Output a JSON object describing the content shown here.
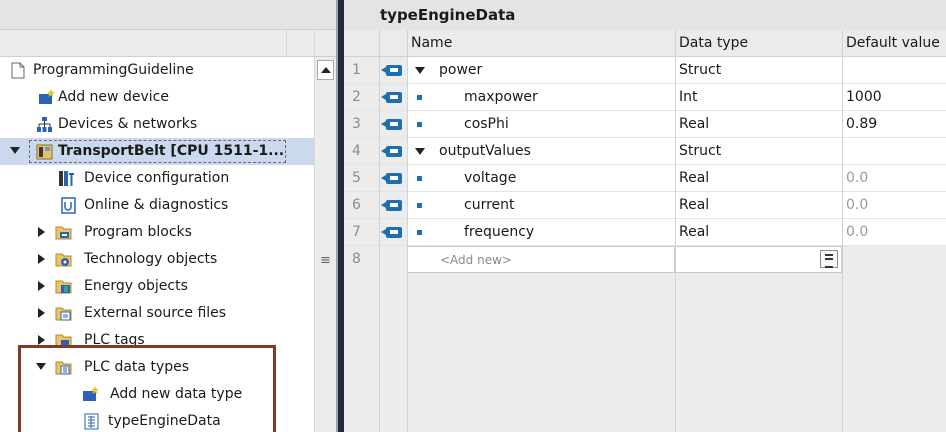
{
  "tree": {
    "items": [
      {
        "label": "ProgrammingGuideline",
        "icon": "project-icon"
      },
      {
        "label": "Add new device",
        "icon": "add-device-icon"
      },
      {
        "label": "Devices & networks",
        "icon": "network-icon"
      },
      {
        "label": "TransportBelt [CPU 1511-1...",
        "icon": "plc-icon"
      },
      {
        "label": "Device configuration",
        "icon": "device-config-icon"
      },
      {
        "label": "Online & diagnostics",
        "icon": "diagnostics-icon"
      },
      {
        "label": "Program blocks",
        "icon": "folder-blocks-icon"
      },
      {
        "label": "Technology objects",
        "icon": "folder-technology-icon"
      },
      {
        "label": "Energy objects",
        "icon": "folder-energy-icon"
      },
      {
        "label": "External source files",
        "icon": "folder-source-icon"
      },
      {
        "label": "PLC tags",
        "icon": "folder-tags-icon"
      },
      {
        "label": "PLC data types",
        "icon": "folder-datatypes-icon"
      },
      {
        "label": "Add new data type",
        "icon": "add-datatype-icon"
      },
      {
        "label": "typeEngineData",
        "icon": "datatype-icon"
      }
    ]
  },
  "editor": {
    "title": "typeEngineData",
    "columns": {
      "name": "Name",
      "type": "Data type",
      "default": "Default value"
    },
    "rows": [
      {
        "num": "1",
        "name": "power",
        "type": "Struct",
        "default": ""
      },
      {
        "num": "2",
        "name": "maxpower",
        "type": "Int",
        "default": "1000"
      },
      {
        "num": "3",
        "name": "cosPhi",
        "type": "Real",
        "default": "0.89"
      },
      {
        "num": "4",
        "name": "outputValues",
        "type": "Struct",
        "default": ""
      },
      {
        "num": "5",
        "name": "voltage",
        "type": "Real",
        "default": "0.0"
      },
      {
        "num": "6",
        "name": "current",
        "type": "Real",
        "default": "0.0"
      },
      {
        "num": "7",
        "name": "frequency",
        "type": "Real",
        "default": "0.0"
      }
    ],
    "add_row": {
      "num": "8",
      "placeholder": "<Add new>"
    }
  },
  "colors": {
    "accent": "#1f6fb0",
    "selection": "#cbd9ef",
    "highlight_frame": "#803a2c"
  }
}
